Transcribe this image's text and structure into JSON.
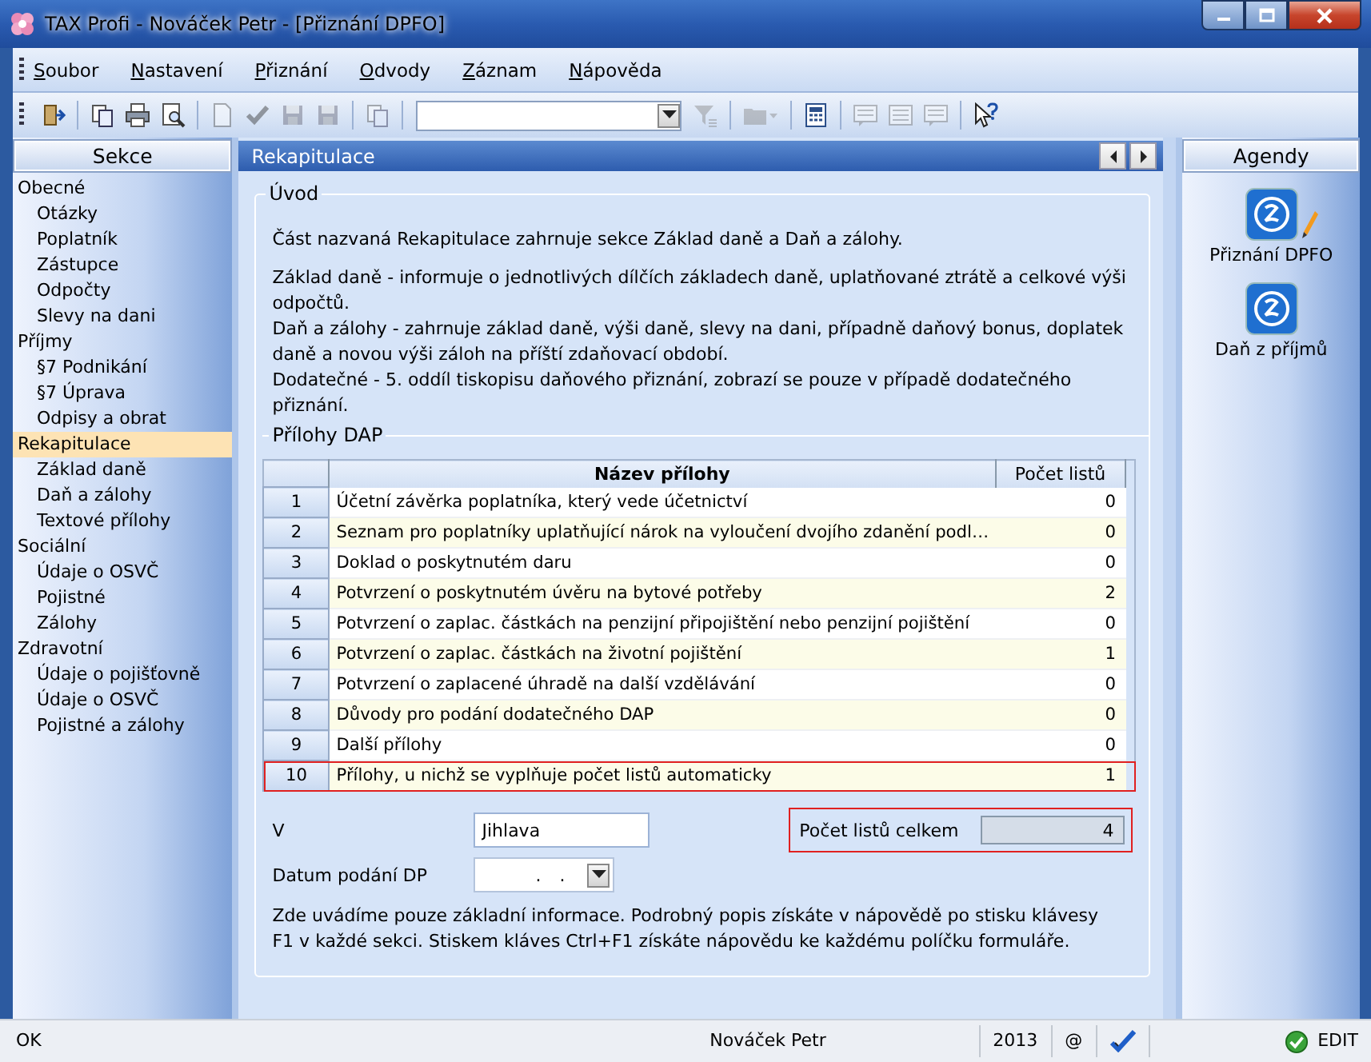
{
  "window": {
    "title": "TAX Profi - Nováček Petr - [Přiznání DPFO]"
  },
  "menu": [
    {
      "label": "Soubor"
    },
    {
      "label": "Nastavení"
    },
    {
      "label": "Přiznání"
    },
    {
      "label": "Odvody"
    },
    {
      "label": "Záznam"
    },
    {
      "label": "Nápověda"
    }
  ],
  "toolbar": [
    {
      "kind": "exit",
      "disabled": false
    },
    {
      "kind": "separator"
    },
    {
      "kind": "copy",
      "disabled": false
    },
    {
      "kind": "print",
      "disabled": false
    },
    {
      "kind": "preview",
      "disabled": false
    },
    {
      "kind": "separator"
    },
    {
      "kind": "new",
      "disabled": true
    },
    {
      "kind": "check",
      "disabled": true
    },
    {
      "kind": "save",
      "disabled": true
    },
    {
      "kind": "save",
      "disabled": true
    },
    {
      "kind": "separator"
    },
    {
      "kind": "copy",
      "disabled": true
    },
    {
      "kind": "separator"
    },
    {
      "kind": "combo",
      "disabled": false
    },
    {
      "kind": "filter",
      "disabled": true
    },
    {
      "kind": "separator"
    },
    {
      "kind": "folder",
      "disabled": true
    },
    {
      "kind": "separator"
    },
    {
      "kind": "calculator",
      "disabled": false
    },
    {
      "kind": "separator"
    },
    {
      "kind": "note",
      "disabled": true
    },
    {
      "kind": "list",
      "disabled": true
    },
    {
      "kind": "note",
      "disabled": true
    },
    {
      "kind": "separator"
    },
    {
      "kind": "help",
      "disabled": false
    }
  ],
  "sidebar": {
    "title": "Sekce",
    "items": [
      {
        "label": "Obecné",
        "selected": false,
        "children": [
          {
            "label": "Otázky",
            "selected": false
          },
          {
            "label": "Poplatník",
            "selected": false
          },
          {
            "label": "Zástupce",
            "selected": false
          },
          {
            "label": "Odpočty",
            "selected": false
          },
          {
            "label": "Slevy na dani",
            "selected": false
          }
        ]
      },
      {
        "label": "Příjmy",
        "selected": false,
        "children": [
          {
            "label": "§7 Podnikání",
            "selected": false
          },
          {
            "label": "§7 Úprava",
            "selected": false
          },
          {
            "label": "Odpisy a obrat",
            "selected": false
          }
        ]
      },
      {
        "label": "Rekapitulace",
        "selected": true,
        "children": [
          {
            "label": "Základ daně",
            "selected": false
          },
          {
            "label": "Daň a zálohy",
            "selected": false
          },
          {
            "label": "Textové přílohy",
            "selected": false
          }
        ]
      },
      {
        "label": "Sociální",
        "selected": false,
        "children": [
          {
            "label": "Údaje o OSVČ",
            "selected": false
          },
          {
            "label": "Pojistné",
            "selected": false
          },
          {
            "label": "Zálohy",
            "selected": false
          }
        ]
      },
      {
        "label": "Zdravotní",
        "selected": false,
        "children": [
          {
            "label": "Údaje o pojišťovně",
            "selected": false
          },
          {
            "label": "Údaje o OSVČ",
            "selected": false
          },
          {
            "label": "Pojistné a zálohy",
            "selected": false
          }
        ]
      }
    ]
  },
  "panel": {
    "title": "Rekapitulace",
    "intro": {
      "title": "Úvod",
      "paragraphs": [
        {
          "lines": [
            "Část nazvaná Rekapitulace zahrnuje sekce Základ daně a Daň a zálohy."
          ]
        },
        {
          "lines": [
            "Základ daně  - informuje o jednotlivých dílčích základech daně, uplatňované ztrátě a celkové výši odpočtů.",
            "Daň a zálohy - zahrnuje základ daně, výši daně, slevy na dani, případně daňový bonus, doplatek daně a novou výši záloh na příští zdaňovací období.",
            "Dodatečné - 5. oddíl tiskopisu daňového přiznání, zobrazí se pouze v případě dodatečného přiznání."
          ]
        }
      ]
    },
    "attachments": {
      "title": "Přílohy DAP",
      "columns": [
        "Název přílohy",
        "Počet listů"
      ],
      "rows": [
        {
          "number": "1",
          "name": "Účetní závěrka poplatníka, který vede účetnictví",
          "count": "0",
          "highlighted": false
        },
        {
          "number": "2",
          "name": "Seznam pro poplatníky uplatňující nárok na vyloučení dvojího zdanění podl…",
          "count": "0",
          "highlighted": false
        },
        {
          "number": "3",
          "name": "Doklad o poskytnutém daru",
          "count": "0",
          "highlighted": false
        },
        {
          "number": "4",
          "name": "Potvrzení o poskytnutém úvěru na bytové potřeby",
          "count": "2",
          "highlighted": false
        },
        {
          "number": "5",
          "name": "Potvrzení o zaplac. částkách na penzijní připojištění nebo penzijní pojištění",
          "count": "0",
          "highlighted": false
        },
        {
          "number": "6",
          "name": "Potvrzení o zaplac. částkách na životní pojištění",
          "count": "1",
          "highlighted": false
        },
        {
          "number": "7",
          "name": "Potvrzení o zaplacené úhradě na další vzdělávání",
          "count": "0",
          "highlighted": false
        },
        {
          "number": "8",
          "name": "Důvody pro podání dodatečného DAP",
          "count": "0",
          "highlighted": false
        },
        {
          "number": "9",
          "name": "Další přílohy",
          "count": "0",
          "highlighted": false
        },
        {
          "number": "10",
          "name": "Přílohy, u nichž se vyplňuje počet listů automaticky",
          "count": "1",
          "highlighted": true
        }
      ]
    },
    "place": {
      "label": "V",
      "value": "Jihlava"
    },
    "date": {
      "label": "Datum podání DP",
      "value": ". ."
    },
    "total": {
      "label": "Počet listů celkem",
      "value": "4",
      "highlighted": true
    },
    "note": "Zde uvádíme pouze základní informace. Podrobný popis získáte v nápovědě po stisku klávesy F1 v každé sekci. Stiskem kláves Ctrl+F1 získáte nápovědu ke každému políčku formuláře."
  },
  "agendas": {
    "title": "Agendy",
    "items": [
      {
        "label": "Přiznání DPFO",
        "active": true
      },
      {
        "label": "Daň z příjmů",
        "active": false
      }
    ]
  },
  "status_bar": {
    "message": "OK",
    "user": "Nováček Petr",
    "year": "2013",
    "at": "@",
    "mode": "EDIT"
  }
}
